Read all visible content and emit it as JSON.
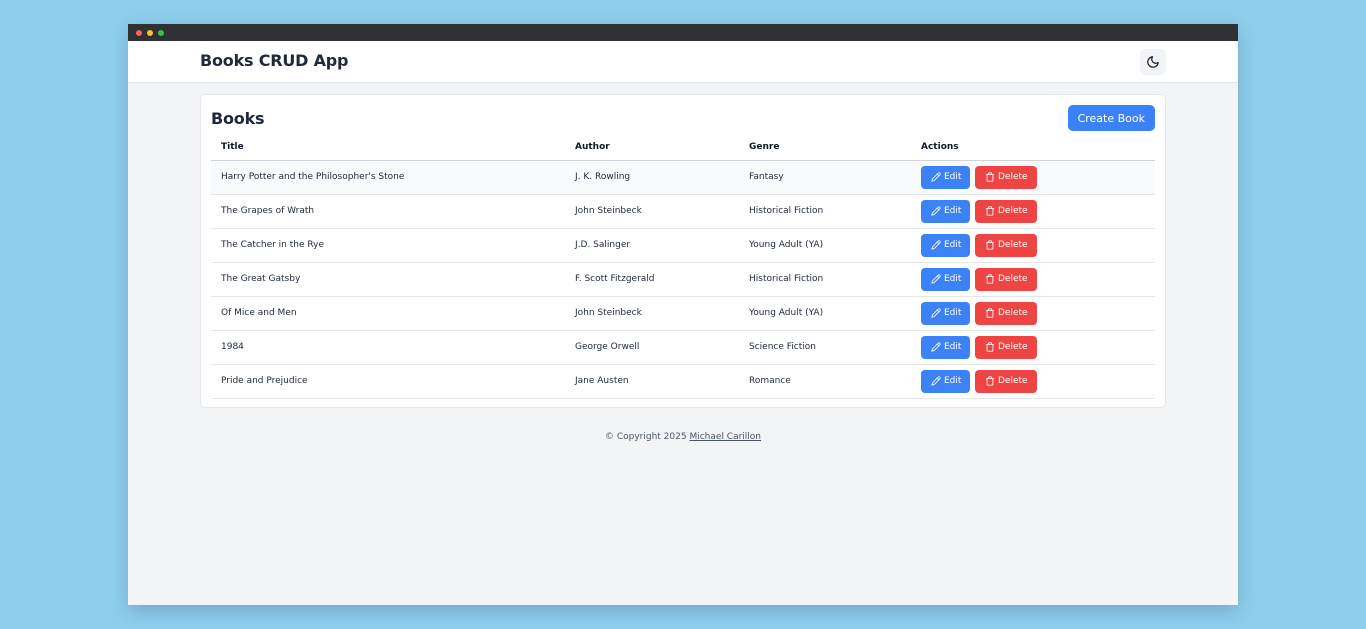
{
  "app": {
    "title": "Books CRUD App"
  },
  "header": {
    "theme_toggle_icon": "moon-icon"
  },
  "books": {
    "title": "Books",
    "create_label": "Create Book",
    "columns": [
      "Title",
      "Author",
      "Genre",
      "Actions"
    ],
    "edit_label": "Edit",
    "delete_label": "Delete",
    "rows": [
      {
        "title": "Harry Potter and the Philosopher's Stone",
        "author": "J. K. Rowling",
        "genre": "Fantasy"
      },
      {
        "title": "The Grapes of Wrath",
        "author": "John Steinbeck",
        "genre": "Historical Fiction"
      },
      {
        "title": "The Catcher in the Rye",
        "author": "J.D. Salinger",
        "genre": "Young Adult (YA)"
      },
      {
        "title": "The Great Gatsby",
        "author": "F. Scott Fitzgerald",
        "genre": "Historical Fiction"
      },
      {
        "title": "Of Mice and Men",
        "author": "John Steinbeck",
        "genre": "Young Adult (YA)"
      },
      {
        "title": "1984",
        "author": "George Orwell",
        "genre": "Science Fiction"
      },
      {
        "title": "Pride and Prejudice",
        "author": "Jane Austen",
        "genre": "Romance"
      }
    ]
  },
  "footer": {
    "copyright": "© Copyright 2025",
    "author_link": "Michael Carillon"
  },
  "colors": {
    "primary": "#3b82f6",
    "danger": "#ef4444",
    "background": "#8ecfee"
  }
}
